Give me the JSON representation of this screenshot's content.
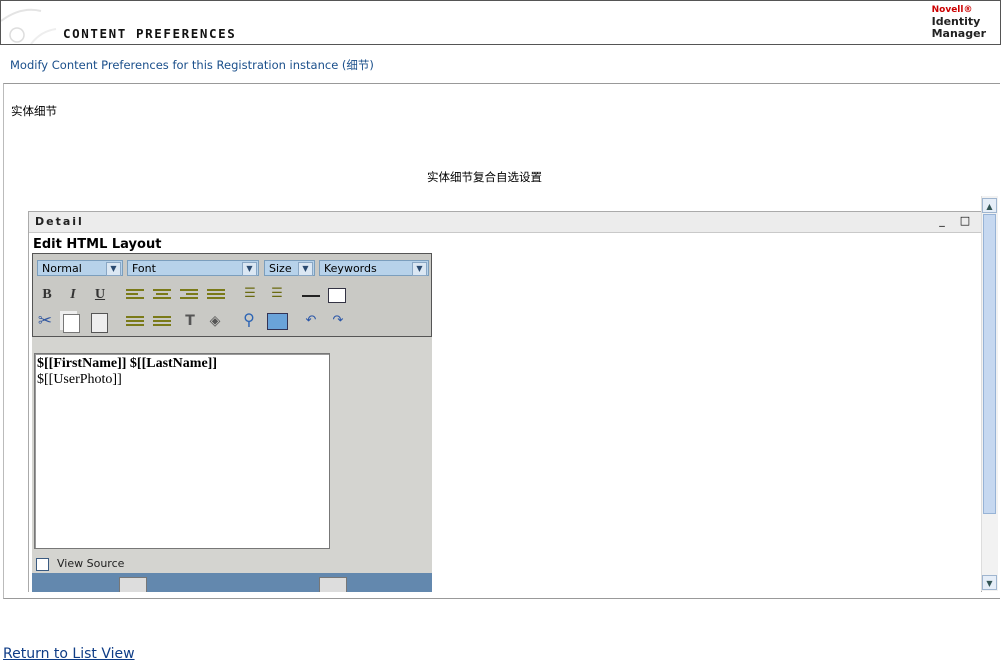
{
  "header": {
    "title": "CONTENT PREFERENCES",
    "brand_company": "Novell®",
    "brand_line1": "Identity",
    "brand_line2": "Manager"
  },
  "modify_link": "Modify Content Preferences for this Registration instance (细节)",
  "entity": {
    "label": "实体细节",
    "description": "实体细节复合自选设置"
  },
  "detail": {
    "title": "Detail",
    "edit_title": "Edit HTML Layout",
    "minimize": "_",
    "maximize": "□"
  },
  "toolbar": {
    "format_select": "Normal",
    "font_select": "Font",
    "size_select": "Size",
    "keywords_select": "Keywords"
  },
  "editor_content": {
    "line1": "$[[FirstName]] $[[LastName]]",
    "line2": "$[[UserPhoto]]"
  },
  "view_source_label": "View Source",
  "return_link": "Return to List View",
  "colors": {
    "link": "#1a4f8b",
    "editor_footer": "#6388ae",
    "select_bg": "#b7d2ea"
  }
}
